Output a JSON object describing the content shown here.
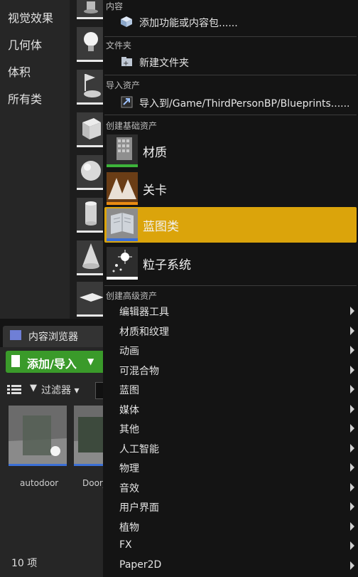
{
  "place_panel": {
    "categories": [
      "视觉效果",
      "几何体",
      "体积",
      "所有类"
    ]
  },
  "content_browser": {
    "tab_label": "内容浏览器",
    "add_button_label": "添加/导入",
    "filter_label": "过滤器",
    "assets": [
      {
        "label": "autodoor"
      },
      {
        "label": "Door_"
      }
    ],
    "item_count": "10 项"
  },
  "menu": {
    "content_section": "内容",
    "add_feature_label": "添加功能或内容包......",
    "folder_section": "文件夹",
    "new_folder_label": "新建文件夹",
    "import_section": "导入资产",
    "import_label": "导入到/Game/ThirdPersonBP/Blueprints......",
    "basic_section": "创建基础资产",
    "basic_items": [
      {
        "label": "材质",
        "bar_color": "#3db33a"
      },
      {
        "label": "关卡",
        "bar_color": "#e98b12"
      },
      {
        "label": "蓝图类",
        "bar_color": "#3b6fd6"
      },
      {
        "label": "粒子系统",
        "bar_color": "#ffffff"
      }
    ],
    "highlighted_item": "蓝图类",
    "advanced_section": "创建高级资产",
    "advanced_items": [
      {
        "label": "编辑器工具"
      },
      {
        "label": "材质和纹理"
      },
      {
        "label": "动画"
      },
      {
        "label": "可混合物"
      },
      {
        "label": "蓝图"
      },
      {
        "label": "媒体"
      },
      {
        "label": "其他"
      },
      {
        "label": "人工智能"
      },
      {
        "label": "物理"
      },
      {
        "label": "音效"
      },
      {
        "label": "用户界面"
      },
      {
        "label": "植物"
      },
      {
        "label": "FX"
      },
      {
        "label": "Paper2D"
      }
    ]
  },
  "colors": {
    "highlight": "#dba40b",
    "add_button": "#3a9a2a",
    "asset_underline": "#3b6fd6"
  }
}
